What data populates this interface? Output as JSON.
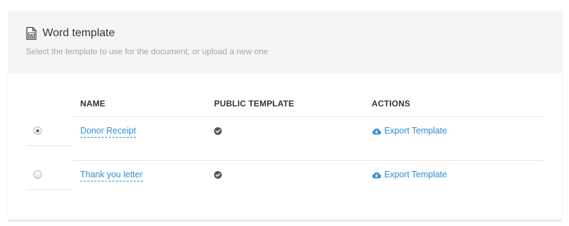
{
  "header": {
    "title": "Word template",
    "subtitle": "Select the template to use for the document, or upload a new one",
    "icon": "word-document-icon"
  },
  "table": {
    "columns": [
      "NAME",
      "PUBLIC TEMPLATE",
      "ACTIONS"
    ],
    "rows": [
      {
        "selected": true,
        "name": "Donor Receipt",
        "public": true,
        "action_label": "Export Template"
      },
      {
        "selected": false,
        "name": "Thank you letter",
        "public": true,
        "action_label": "Export Template"
      }
    ]
  },
  "colors": {
    "link": "#2d8ed8",
    "header_bg": "#f5f5f5",
    "subtitle": "#a5a5a5",
    "check": "#555555"
  }
}
